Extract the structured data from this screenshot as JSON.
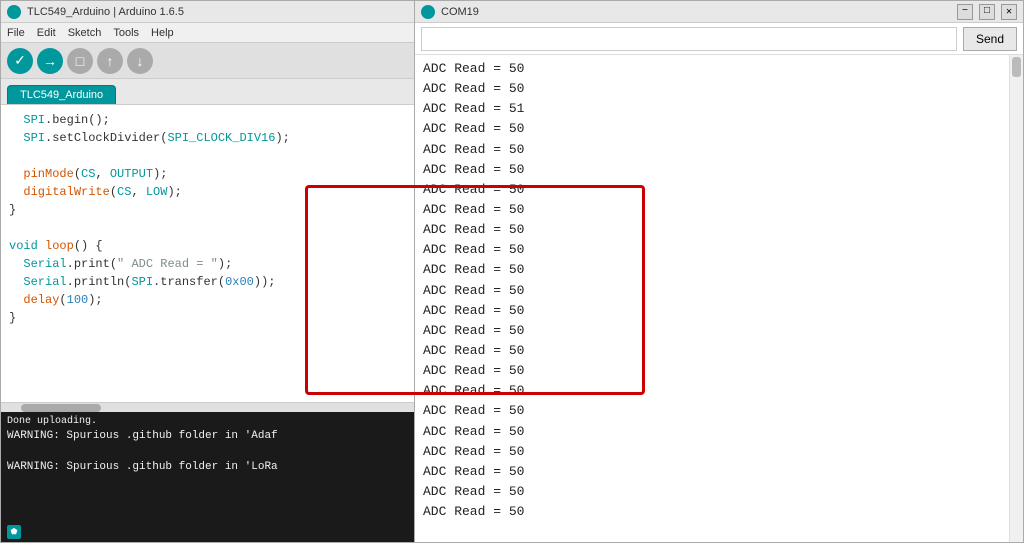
{
  "arduino_window": {
    "title": "TLC549_Arduino | Arduino 1.6.5",
    "tab_name": "TLC549_Arduino",
    "menu": [
      "File",
      "Edit",
      "Sketch",
      "Tools",
      "Help"
    ],
    "code_lines": [
      "SPI.begin();",
      "SPI.setClockDivider(SPI_CLOCK_DIV16);",
      "",
      "pinMode(CS, OUTPUT);",
      "digitalWrite(CS, LOW);",
      "}"
    ],
    "code_loop": [
      "",
      "void loop() {",
      "  Serial.print(\" ADC Read = \");",
      "  Serial.println(SPI.transfer(0x00));",
      "  delay(100);",
      "}"
    ],
    "console": {
      "label": "Done uploading.",
      "lines": [
        "WARNING: Spurious .github folder in 'Adaf",
        "",
        "WARNING: Spurious .github folder in 'LoRa"
      ]
    }
  },
  "serial_window": {
    "title": "COM19",
    "send_label": "Send",
    "output_lines": [
      "ADC Read = 50",
      "ADC Read = 50",
      "ADC Read = 51",
      "ADC Read = 50",
      "ADC Read = 50",
      "ADC Read = 50",
      "ADC Read = 50",
      "ADC Read = 50",
      "ADC Read = 50",
      "ADC Read = 50",
      "ADC Read = 50",
      "ADC Read = 50",
      "ADC Read = 50",
      "ADC Read = 50",
      "ADC Read = 50",
      "ADC Read = 50",
      "ADC Read = 50",
      "ADC Read = 50",
      "ADC Read = 50",
      "ADC Read = 50",
      "ADC Read = 50",
      "ADC Read = 50",
      "ADC Read = 50"
    ]
  }
}
